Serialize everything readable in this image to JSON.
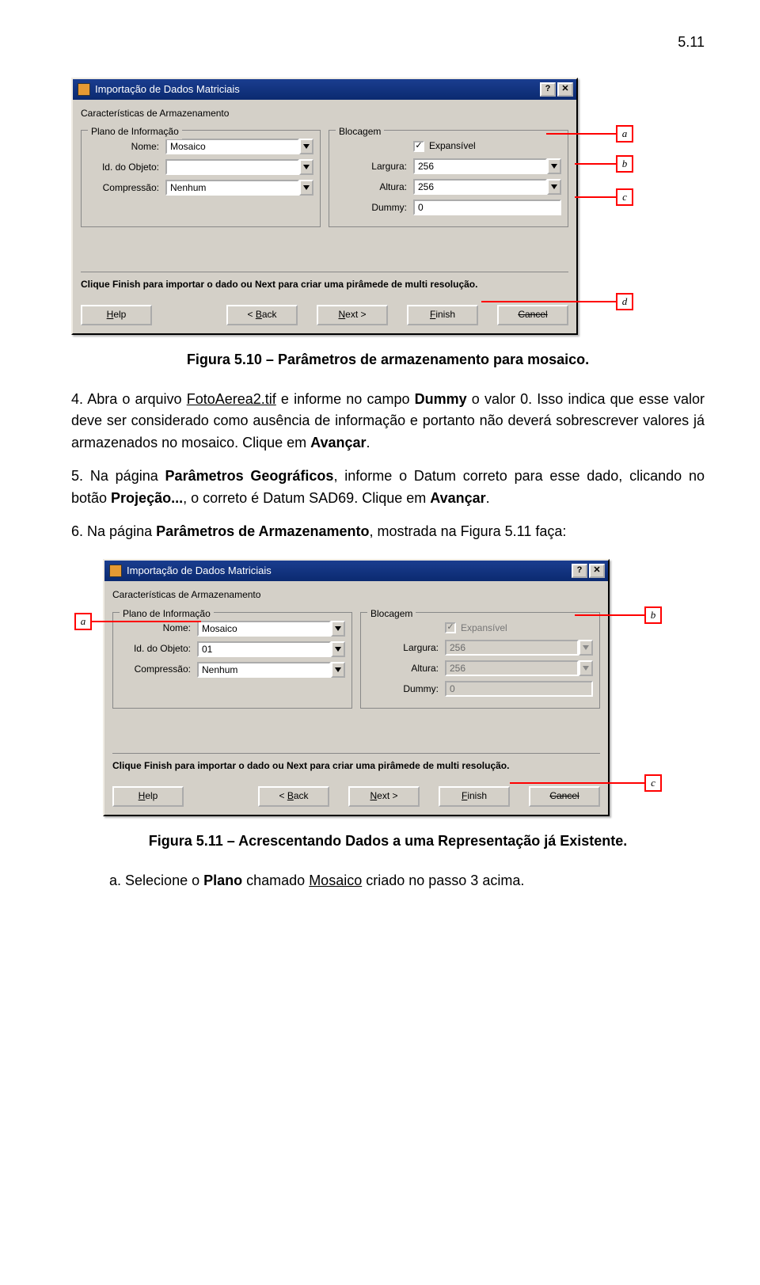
{
  "page_number": "5.11",
  "dialog1": {
    "title": "Importação de Dados Matriciais",
    "section_label": "Características de Armazenamento",
    "group_plano": "Plano de Informação",
    "group_bloc": "Blocagem",
    "labels": {
      "nome": "Nome:",
      "id": "Id. do Objeto:",
      "comp": "Compressão:",
      "exp": "Expansível",
      "larg": "Largura:",
      "alt": "Altura:",
      "dummy": "Dummy:"
    },
    "values": {
      "nome": "Mosaico",
      "id": "",
      "comp": "Nenhum",
      "larg": "256",
      "alt": "256",
      "dummy": "0"
    },
    "hint": "Clique Finish para importar o dado ou Next para criar uma pirâmede de multi resolução.",
    "buttons": {
      "help": "Help",
      "back": "< Back",
      "next": "Next >",
      "finish": "Finish",
      "cancel": "Cancel"
    },
    "markers": {
      "a": "a",
      "b": "b",
      "c": "c",
      "d": "d"
    }
  },
  "caption1": "Figura 5.10 – Parâmetros de armazenamento para mosaico.",
  "step4": {
    "num": "4.",
    "p1a": "Abra o arquivo ",
    "file": "FotoAerea2.tif",
    "p1b": " e informe no campo ",
    "bold1": "Dummy",
    "p1c": " o valor 0. Isso indica que esse valor deve ser considerado como ausência de informação e portanto não deverá sobrescrever valores já armazenados no mosaico. Clique em ",
    "bold2": "Avançar",
    "p1d": "."
  },
  "step5": {
    "num": "5.",
    "p1a": "Na página ",
    "bold1": "Parâmetros Geográficos",
    "p1b": ", informe o Datum correto para esse dado, clicando no botão ",
    "bold2": "Projeção...",
    "p1c": ", o correto é Datum SAD69. Clique em ",
    "bold3": "Avançar",
    "p1d": "."
  },
  "step6": {
    "num": "6.",
    "p1a": "Na página ",
    "bold1": "Parâmetros de Armazenamento",
    "p1b": ", mostrada na Figura 5.11 faça:"
  },
  "dialog2": {
    "title": "Importação de Dados Matriciais",
    "section_label": "Características de Armazenamento",
    "group_plano": "Plano de Informação",
    "group_bloc": "Blocagem",
    "labels": {
      "nome": "Nome:",
      "id": "Id. do Objeto:",
      "comp": "Compressão:",
      "exp": "Expansível",
      "larg": "Largura:",
      "alt": "Altura:",
      "dummy": "Dummy:"
    },
    "values": {
      "nome": "Mosaico",
      "id": "01",
      "comp": "Nenhum",
      "larg": "256",
      "alt": "256",
      "dummy": "0"
    },
    "hint": "Clique Finish para importar o dado ou Next para criar uma pirâmede de multi resolução.",
    "buttons": {
      "help": "Help",
      "back": "< Back",
      "next": "Next >",
      "finish": "Finish",
      "cancel": "Cancel"
    },
    "markers": {
      "a": "a",
      "b": "b",
      "c": "c"
    }
  },
  "caption2": "Figura 5.11 – Acrescentando Dados a uma Representação já Existente.",
  "sub_a": {
    "num": "a.",
    "p1a": "Selecione o ",
    "bold1": "Plano",
    "p1b": " chamado ",
    "und1": "Mosaico",
    "p1c": " criado no passo 3 acima."
  }
}
